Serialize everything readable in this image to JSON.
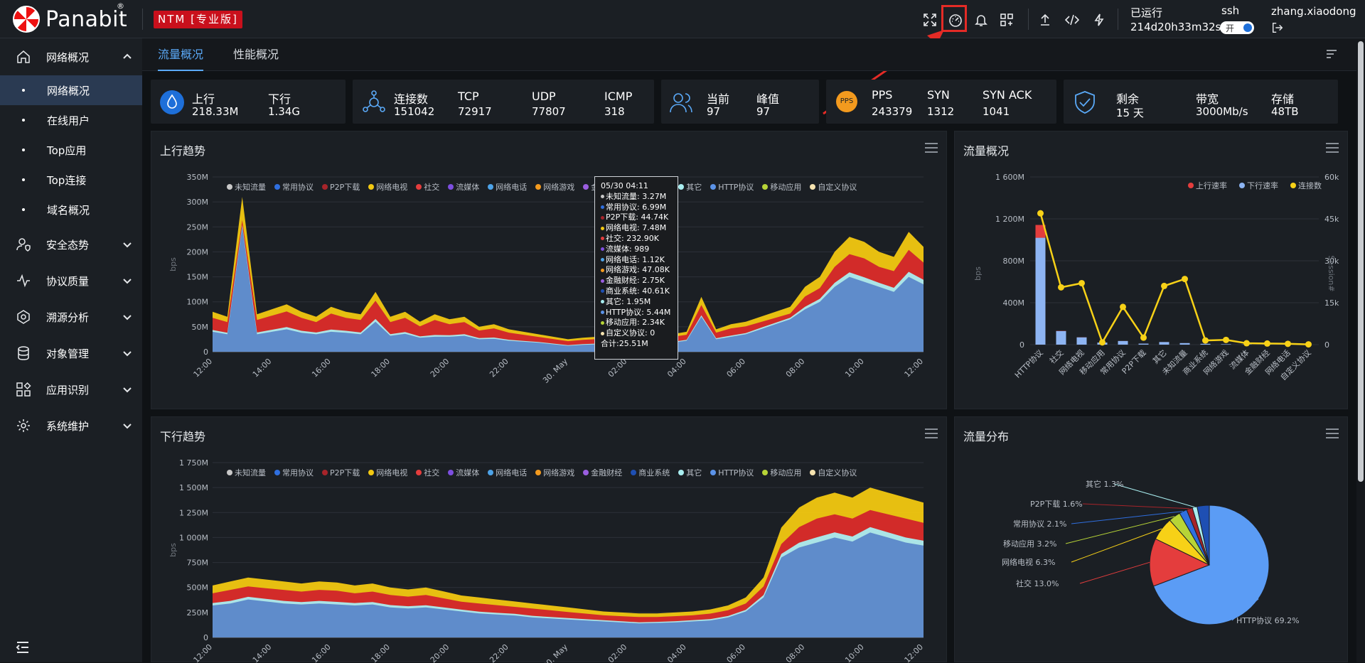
{
  "header": {
    "brand": "Panabit",
    "brand_mark": "®",
    "edition_badge": "NTM [专业版]",
    "uptime_label": "已运行",
    "uptime_value": "214d20h33m32s",
    "ssh_label": "ssh",
    "ssh_toggle_text": "开",
    "ssh_enabled": true,
    "username": "zhang.xiaodong",
    "icons": [
      "fullscreen-icon",
      "dashboard-icon",
      "bell-icon",
      "apps-grid-icon",
      "upload-icon",
      "code-icon",
      "bolt-icon",
      "logout-icon"
    ],
    "highlight_color": "#e42b26"
  },
  "sidebar": {
    "items": [
      {
        "label": "网络概况",
        "icon": "home-icon",
        "expanded": true,
        "children": [
          "网络概况",
          "在线用户",
          "Top应用",
          "Top连接",
          "域名概况"
        ],
        "active_child": 0
      },
      {
        "label": "安全态势",
        "icon": "user-shield-icon"
      },
      {
        "label": "协议质量",
        "icon": "pulse-icon"
      },
      {
        "label": "溯源分析",
        "icon": "network-trace-icon"
      },
      {
        "label": "对象管理",
        "icon": "database-icon"
      },
      {
        "label": "应用识别",
        "icon": "app-blocks-icon"
      },
      {
        "label": "系统维护",
        "icon": "gear-icon"
      }
    ]
  },
  "tabs": [
    {
      "label": "流量概况",
      "active": true
    },
    {
      "label": "性能概况",
      "active": false
    }
  ],
  "stats": {
    "traffic": {
      "up_label": "上行",
      "up_value": "218.33M",
      "down_label": "下行",
      "down_value": "1.34G"
    },
    "connections": {
      "conn_label": "连接数",
      "conn_value": "151042",
      "tcp_label": "TCP",
      "tcp_value": "72917",
      "udp_label": "UDP",
      "udp_value": "77807",
      "icmp_label": "ICMP",
      "icmp_value": "318"
    },
    "users": {
      "current_label": "当前",
      "current_value": "97",
      "peak_label": "峰值",
      "peak_value": "97"
    },
    "packets": {
      "badge": "PPS",
      "pps_label": "PPS",
      "pps_value": "243379",
      "syn_label": "SYN",
      "syn_value": "1312",
      "synack_label": "SYN ACK",
      "synack_value": "1041"
    },
    "license": {
      "remain_label": "剩余",
      "remain_value": "15 天",
      "bw_label": "带宽",
      "bw_value": "3000Mb/s",
      "storage_label": "存储",
      "storage_value": "48TB"
    }
  },
  "panels": {
    "up_trend": {
      "title": "上行趋势"
    },
    "down_trend": {
      "title": "下行趋势"
    },
    "overview": {
      "title": "流量概况"
    },
    "distribution": {
      "title": "流量分布"
    }
  },
  "legend_series": [
    {
      "name": "未知流量",
      "color": "#c8c8c8"
    },
    {
      "name": "常用协议",
      "color": "#2f6fe0"
    },
    {
      "name": "P2P下载",
      "color": "#a7242a"
    },
    {
      "name": "网络电视",
      "color": "#f2c811"
    },
    {
      "name": "社交",
      "color": "#e43d3d"
    },
    {
      "name": "流媒体",
      "color": "#7d4ee0"
    },
    {
      "name": "网络电话",
      "color": "#4da3e8"
    },
    {
      "name": "网络游戏",
      "color": "#f39a1e"
    },
    {
      "name": "金融财经",
      "color": "#9a5ee0"
    },
    {
      "name": "商业系统",
      "color": "#1e4fb3"
    },
    {
      "name": "其它",
      "color": "#a9eef0"
    },
    {
      "name": "HTTP协议",
      "color": "#5b93e8"
    },
    {
      "name": "移动应用",
      "color": "#b7d437"
    },
    {
      "name": "自定义协议",
      "color": "#f5e3b0"
    }
  ],
  "tooltip": {
    "time": "05/30 04:11",
    "rows": [
      {
        "name": "未知流量",
        "value": "3.27M",
        "color": "#c8c8c8"
      },
      {
        "name": "常用协议",
        "value": "6.99M",
        "color": "#2f6fe0"
      },
      {
        "name": "P2P下载",
        "value": "44.74K",
        "color": "#a7242a"
      },
      {
        "name": "网络电视",
        "value": "7.48M",
        "color": "#f2c811"
      },
      {
        "name": "社交",
        "value": "232.90K",
        "color": "#e43d3d"
      },
      {
        "name": "流媒体",
        "value": "989",
        "color": "#7d4ee0"
      },
      {
        "name": "网络电话",
        "value": "1.12K",
        "color": "#4da3e8"
      },
      {
        "name": "网络游戏",
        "value": "47.08K",
        "color": "#f39a1e"
      },
      {
        "name": "金融财经",
        "value": "2.75K",
        "color": "#9a5ee0"
      },
      {
        "name": "商业系统",
        "value": "40.61K",
        "color": "#1e4fb3"
      },
      {
        "name": "其它",
        "value": "1.95M",
        "color": "#a9eef0"
      },
      {
        "name": "HTTP协议",
        "value": "5.44M",
        "color": "#5b93e8"
      },
      {
        "name": "移动应用",
        "value": "2.34K",
        "color": "#b7d437"
      },
      {
        "name": "自定义协议",
        "value": "0",
        "color": "#f5e3b0"
      }
    ],
    "total": "合计:25.51M"
  },
  "chart_data": [
    {
      "type": "area",
      "title": "上行趋势",
      "ylabel": "bps",
      "x_ticks": [
        "12:00",
        "14:00",
        "16:00",
        "18:00",
        "20:00",
        "22:00",
        "30. May",
        "02:00",
        "04:00",
        "06:00",
        "08:00",
        "10:00",
        "12:00"
      ],
      "y_ticks": [
        "0",
        "50M",
        "100M",
        "150M",
        "200M",
        "250M",
        "300M",
        "350M"
      ],
      "ylim": [
        0,
        350
      ],
      "y_unit": "M",
      "series_total_M": [
        80,
        70,
        310,
        75,
        85,
        95,
        80,
        70,
        90,
        80,
        75,
        120,
        70,
        80,
        60,
        75,
        65,
        70,
        50,
        55,
        45,
        40,
        35,
        30,
        25,
        28,
        30,
        26,
        25,
        28,
        30,
        35,
        40,
        110,
        45,
        55,
        60,
        70,
        80,
        90,
        130,
        150,
        200,
        230,
        220,
        200,
        190,
        240,
        210
      ],
      "series_http_M": [
        40,
        35,
        250,
        35,
        40,
        45,
        38,
        35,
        40,
        38,
        35,
        60,
        32,
        36,
        28,
        30,
        30,
        32,
        25,
        26,
        22,
        20,
        18,
        15,
        12,
        14,
        15,
        14,
        13,
        15,
        16,
        18,
        22,
        70,
        25,
        30,
        35,
        45,
        55,
        65,
        85,
        100,
        130,
        150,
        140,
        130,
        120,
        150,
        135
      ],
      "series_social_M": [
        18,
        16,
        20,
        18,
        20,
        22,
        20,
        18,
        22,
        20,
        18,
        28,
        16,
        18,
        14,
        18,
        15,
        16,
        12,
        12,
        10,
        9,
        8,
        7,
        6,
        6,
        7,
        6,
        6,
        6,
        7,
        8,
        9,
        15,
        10,
        12,
        12,
        14,
        15,
        16,
        25,
        30,
        40,
        45,
        45,
        40,
        40,
        50,
        45
      ]
    },
    {
      "type": "area",
      "title": "下行趋势",
      "ylabel": "bps",
      "x_ticks": [
        "12:00",
        "14:00",
        "16:00",
        "18:00",
        "20:00",
        "22:00",
        "30. May",
        "02:00",
        "04:00",
        "06:00",
        "08:00",
        "10:00",
        "12:00"
      ],
      "y_ticks": [
        "0",
        "250M",
        "500M",
        "750M",
        "1 000M",
        "1 250M",
        "1 500M",
        "1 750M"
      ],
      "ylim": [
        0,
        1750
      ],
      "y_unit": "M",
      "series_total_M": [
        520,
        560,
        600,
        580,
        560,
        540,
        560,
        550,
        520,
        540,
        500,
        480,
        500,
        460,
        420,
        400,
        380,
        360,
        340,
        320,
        300,
        280,
        260,
        250,
        240,
        240,
        250,
        260,
        280,
        320,
        400,
        600,
        1100,
        1300,
        1400,
        1450,
        1400,
        1500,
        1450,
        1400,
        1350
      ],
      "series_http_M": [
        320,
        340,
        380,
        360,
        340,
        330,
        340,
        330,
        320,
        330,
        300,
        290,
        300,
        280,
        260,
        240,
        230,
        220,
        200,
        190,
        180,
        170,
        160,
        150,
        140,
        145,
        150,
        160,
        170,
        200,
        260,
        400,
        800,
        900,
        950,
        1000,
        960,
        1050,
        1000,
        950,
        920
      ],
      "series_social_M": [
        120,
        130,
        130,
        130,
        130,
        120,
        130,
        130,
        120,
        120,
        120,
        110,
        110,
        100,
        90,
        90,
        80,
        80,
        80,
        70,
        70,
        60,
        60,
        60,
        55,
        55,
        60,
        60,
        65,
        70,
        80,
        120,
        180,
        240,
        260,
        260,
        250,
        270,
        260,
        250,
        240
      ]
    },
    {
      "type": "bar",
      "title": "流量概况",
      "legend": [
        "上行速率",
        "下行速率",
        "连接数"
      ],
      "colors": {
        "up": "#e43d3d",
        "down": "#8db4f2",
        "conn": "#f7d117"
      },
      "categories": [
        "HTTP协议",
        "社交",
        "网络电视",
        "移动应用",
        "常用协议",
        "P2P下载",
        "其它",
        "未知流量",
        "商业系统",
        "网络游戏",
        "流媒体",
        "金融财经",
        "网络电话",
        "自定义协议"
      ],
      "up_M": [
        170,
        20,
        10,
        3,
        5,
        2,
        3,
        2,
        1,
        1,
        0,
        0,
        0,
        0
      ],
      "down_M": [
        1020,
        130,
        70,
        20,
        35,
        10,
        25,
        15,
        8,
        4,
        2,
        1,
        1,
        0
      ],
      "connections": [
        47000,
        20500,
        22000,
        800,
        13500,
        2500,
        21000,
        23500,
        1500,
        1700,
        500,
        400,
        300,
        100
      ],
      "y_left_ticks": [
        "0",
        "400M",
        "800M",
        "1 200M",
        "1 600M"
      ],
      "y_right_ticks": [
        "0",
        "15k",
        "30k",
        "45k",
        "60k"
      ],
      "ylabel_left": "bps",
      "ylabel_right": "Session#"
    },
    {
      "type": "pie",
      "title": "流量分布",
      "slices": [
        {
          "label": "HTTP协议",
          "value": 69.2,
          "color": "#5b9cf5"
        },
        {
          "label": "社交",
          "value": 13.0,
          "color": "#e43d3d"
        },
        {
          "label": "网络电视",
          "value": 6.3,
          "color": "#f7d117"
        },
        {
          "label": "移动应用",
          "value": 3.2,
          "color": "#b7d437"
        },
        {
          "label": "常用协议",
          "value": 2.1,
          "color": "#2f6fe0"
        },
        {
          "label": "P2P下载",
          "value": 1.6,
          "color": "#a7242a"
        },
        {
          "label": "其它",
          "value": 1.3,
          "color": "#a9eef0"
        },
        {
          "label": "",
          "value": 3.3,
          "color": "#1e4fb3"
        }
      ],
      "labels_text": [
        "HTTP协议 69.2%",
        "社交 13.0%",
        "网络电视 6.3%",
        "移动应用 3.2%",
        "常用协议 2.1%",
        "P2P下载 1.6%",
        "其它 1.3%"
      ]
    }
  ]
}
